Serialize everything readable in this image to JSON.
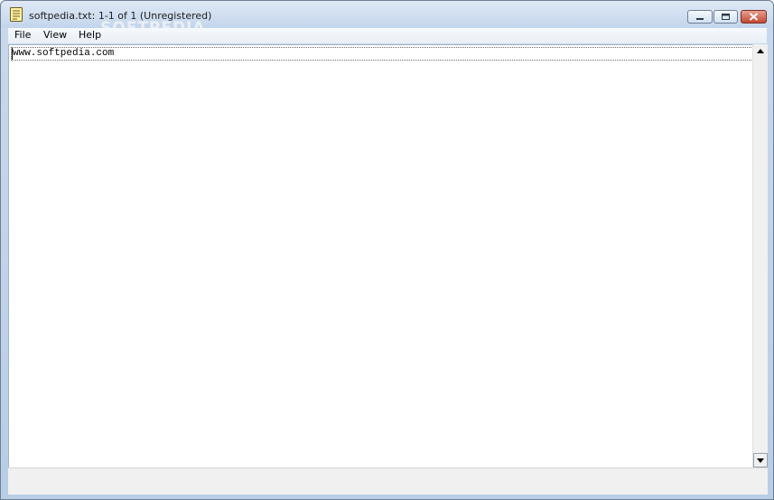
{
  "window": {
    "title": "softpedia.txt: 1-1 of 1 (Unregistered)",
    "watermark": "SOFTPEDIA"
  },
  "titlebar": {
    "icons": {
      "app": "notepad-icon",
      "minimize": "minimize-icon",
      "maximize": "maximize-icon",
      "close": "close-icon"
    }
  },
  "menubar": {
    "items": [
      {
        "label": "File"
      },
      {
        "label": "View"
      },
      {
        "label": "Help"
      }
    ]
  },
  "editor": {
    "lines": [
      "www.softpedia.com"
    ]
  },
  "scrollbar": {
    "icons": {
      "up": "arrow-up-icon",
      "down": "arrow-down-icon"
    }
  },
  "colors": {
    "title_bar": "#c3d5ec",
    "close_button": "#c14a32",
    "editor_background": "#ffffff",
    "status_bar": "#f0f0f0"
  }
}
